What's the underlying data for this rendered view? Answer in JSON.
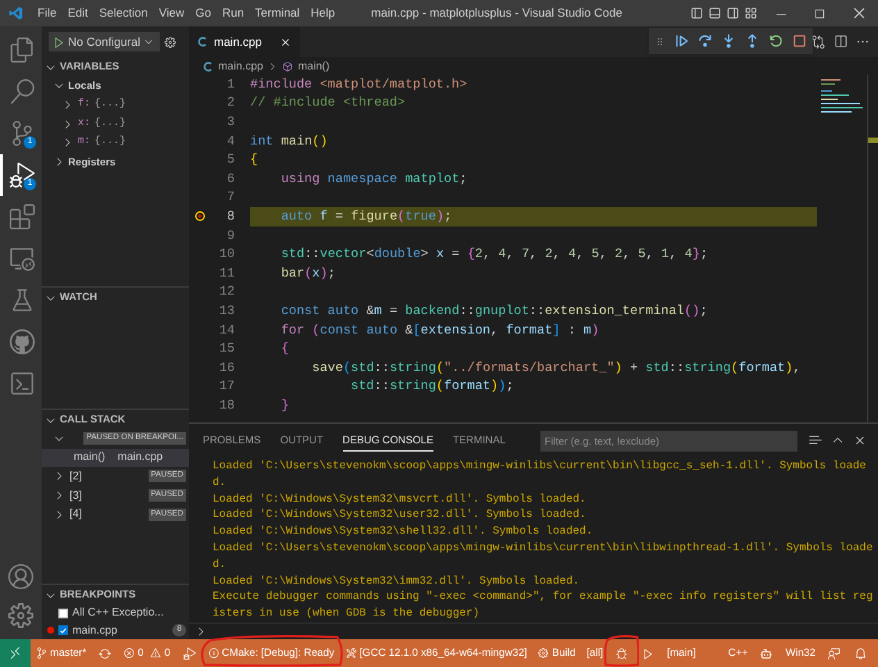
{
  "title_bar": {
    "menu": [
      "File",
      "Edit",
      "Selection",
      "View",
      "Go",
      "Run",
      "Terminal",
      "Help"
    ],
    "title": "main.cpp - matplotplusplus - Visual Studio Code"
  },
  "activity_bar": {
    "items": [
      {
        "kind": "explorer",
        "selected": false
      },
      {
        "kind": "search",
        "selected": false
      },
      {
        "kind": "scm",
        "selected": false,
        "badge": "1"
      },
      {
        "kind": "debug",
        "selected": true,
        "badge": "1"
      },
      {
        "kind": "extensions",
        "selected": false
      },
      {
        "kind": "remote",
        "selected": false
      },
      {
        "kind": "testing",
        "selected": false
      },
      {
        "kind": "github",
        "selected": false
      },
      {
        "kind": "terminal",
        "selected": false
      }
    ],
    "bottom": [
      {
        "kind": "account"
      },
      {
        "kind": "settings"
      }
    ]
  },
  "run_toolbar": {
    "configuration": "No Configural"
  },
  "variables": {
    "title": "VARIABLES",
    "scopes": [
      {
        "label": "Locals",
        "expanded": true,
        "children": [
          {
            "name": "f:",
            "value": "{...}"
          },
          {
            "name": "x:",
            "value": "{...}"
          },
          {
            "name": "m:",
            "value": "{...}"
          }
        ]
      },
      {
        "label": "Registers",
        "expanded": false
      }
    ]
  },
  "watch": {
    "title": "WATCH"
  },
  "call_stack": {
    "title": "CALL STACK",
    "threads": [
      {
        "state": "PAUSED ON BREAKPOI...",
        "expanded": true,
        "frames": [
          {
            "function": "main()",
            "file": "main.cpp",
            "selected": true
          }
        ]
      },
      {
        "label": "[2]",
        "state": "PAUSED",
        "expanded": false
      },
      {
        "label": "[3]",
        "state": "PAUSED",
        "expanded": false
      },
      {
        "label": "[4]",
        "state": "PAUSED",
        "expanded": false
      }
    ]
  },
  "breakpoints": {
    "title": "BREAKPOINTS",
    "items": [
      {
        "kind": "exception",
        "label": "All C++ Exceptio...",
        "checked": false
      },
      {
        "kind": "file",
        "label": "main.cpp",
        "checked": true,
        "line": "8"
      }
    ]
  },
  "editor": {
    "tabs": [
      {
        "label": "main.cpp",
        "selected": true
      }
    ],
    "breadcrumbs": [
      "main.cpp",
      "main()"
    ],
    "lines": [
      {
        "number": "1",
        "tokens": [
          {
            "kind": "ctrl",
            "text": "#include "
          },
          {
            "kind": "str",
            "text": "<matplot/matplot.h>"
          }
        ]
      },
      {
        "number": "2",
        "tokens": [
          {
            "kind": "cmt",
            "text": "// #include <thread>"
          }
        ]
      },
      {
        "number": "3"
      },
      {
        "number": "4",
        "tokens": [
          {
            "kind": "kw",
            "text": "int "
          },
          {
            "kind": "fn",
            "text": "main"
          },
          {
            "kind": "b1",
            "text": "()"
          }
        ]
      },
      {
        "number": "5",
        "tokens": [
          {
            "kind": "b1",
            "text": "{"
          }
        ]
      },
      {
        "number": "6",
        "tokens": [
          {
            "kind": "ctrl",
            "text": "    using "
          },
          {
            "kind": "kw",
            "text": "namespace "
          },
          {
            "kind": "type",
            "text": "matplot"
          },
          {
            "kind": "p",
            "text": ";"
          }
        ]
      },
      {
        "number": "7"
      },
      {
        "number": "8",
        "paused": true,
        "tokens": [
          {
            "kind": "kw",
            "text": "    auto "
          },
          {
            "kind": "var",
            "text": "f"
          },
          {
            "kind": "p",
            "text": " = "
          },
          {
            "kind": "fn",
            "text": "figure"
          },
          {
            "kind": "b2",
            "text": "("
          },
          {
            "kind": "kw",
            "text": "true"
          },
          {
            "kind": "b2",
            "text": ")"
          },
          {
            "kind": "p",
            "text": ";"
          }
        ]
      },
      {
        "number": "9"
      },
      {
        "number": "10",
        "tokens": [
          {
            "kind": "type",
            "text": "    std"
          },
          {
            "kind": "p",
            "text": "::"
          },
          {
            "kind": "type",
            "text": "vector"
          },
          {
            "kind": "p",
            "text": "<"
          },
          {
            "kind": "kw",
            "text": "double"
          },
          {
            "kind": "p",
            "text": "> "
          },
          {
            "kind": "var",
            "text": "x"
          },
          {
            "kind": "p",
            "text": " = "
          },
          {
            "kind": "b2",
            "text": "{"
          },
          {
            "kind": "num",
            "text": "2"
          },
          {
            "kind": "p",
            "text": ", "
          },
          {
            "kind": "num",
            "text": "4"
          },
          {
            "kind": "p",
            "text": ", "
          },
          {
            "kind": "num",
            "text": "7"
          },
          {
            "kind": "p",
            "text": ", "
          },
          {
            "kind": "num",
            "text": "2"
          },
          {
            "kind": "p",
            "text": ", "
          },
          {
            "kind": "num",
            "text": "4"
          },
          {
            "kind": "p",
            "text": ", "
          },
          {
            "kind": "num",
            "text": "5"
          },
          {
            "kind": "p",
            "text": ", "
          },
          {
            "kind": "num",
            "text": "2"
          },
          {
            "kind": "p",
            "text": ", "
          },
          {
            "kind": "num",
            "text": "5"
          },
          {
            "kind": "p",
            "text": ", "
          },
          {
            "kind": "num",
            "text": "1"
          },
          {
            "kind": "p",
            "text": ", "
          },
          {
            "kind": "num",
            "text": "4"
          },
          {
            "kind": "b2",
            "text": "}"
          },
          {
            "kind": "p",
            "text": ";"
          }
        ]
      },
      {
        "number": "11",
        "tokens": [
          {
            "kind": "fn",
            "text": "    bar"
          },
          {
            "kind": "b2",
            "text": "("
          },
          {
            "kind": "var",
            "text": "x"
          },
          {
            "kind": "b2",
            "text": ")"
          },
          {
            "kind": "p",
            "text": ";"
          }
        ]
      },
      {
        "number": "12"
      },
      {
        "number": "13",
        "tokens": [
          {
            "kind": "kw",
            "text": "    const auto "
          },
          {
            "kind": "p",
            "text": "&"
          },
          {
            "kind": "var",
            "text": "m"
          },
          {
            "kind": "p",
            "text": " = "
          },
          {
            "kind": "type",
            "text": "backend"
          },
          {
            "kind": "p",
            "text": "::"
          },
          {
            "kind": "type",
            "text": "gnuplot"
          },
          {
            "kind": "p",
            "text": "::"
          },
          {
            "kind": "fn",
            "text": "extension_terminal"
          },
          {
            "kind": "b2",
            "text": "()"
          },
          {
            "kind": "p",
            "text": ";"
          }
        ]
      },
      {
        "number": "14",
        "tokens": [
          {
            "kind": "ctrl",
            "text": "    for "
          },
          {
            "kind": "b2",
            "text": "("
          },
          {
            "kind": "kw",
            "text": "const auto "
          },
          {
            "kind": "p",
            "text": "&"
          },
          {
            "kind": "b3",
            "text": "["
          },
          {
            "kind": "var",
            "text": "extension"
          },
          {
            "kind": "p",
            "text": ", "
          },
          {
            "kind": "var",
            "text": "format"
          },
          {
            "kind": "b3",
            "text": "]"
          },
          {
            "kind": "p",
            "text": " : "
          },
          {
            "kind": "var",
            "text": "m"
          },
          {
            "kind": "b2",
            "text": ")"
          }
        ]
      },
      {
        "number": "15",
        "tokens": [
          {
            "kind": "b2",
            "text": "    {"
          }
        ]
      },
      {
        "number": "16",
        "tokens": [
          {
            "kind": "fn",
            "text": "        save"
          },
          {
            "kind": "b3",
            "text": "("
          },
          {
            "kind": "type",
            "text": "std"
          },
          {
            "kind": "p",
            "text": "::"
          },
          {
            "kind": "type",
            "text": "string"
          },
          {
            "kind": "b1",
            "text": "("
          },
          {
            "kind": "str",
            "text": "\"../formats/barchart_\""
          },
          {
            "kind": "b1",
            "text": ")"
          },
          {
            "kind": "p",
            "text": " + "
          },
          {
            "kind": "type",
            "text": "std"
          },
          {
            "kind": "p",
            "text": "::"
          },
          {
            "kind": "type",
            "text": "string"
          },
          {
            "kind": "b1",
            "text": "("
          },
          {
            "kind": "var",
            "text": "format"
          },
          {
            "kind": "b1",
            "text": ")"
          },
          {
            "kind": "p",
            "text": ","
          }
        ]
      },
      {
        "number": "17",
        "tokens": [
          {
            "kind": "type",
            "text": "             std"
          },
          {
            "kind": "p",
            "text": "::"
          },
          {
            "kind": "type",
            "text": "string"
          },
          {
            "kind": "b1",
            "text": "("
          },
          {
            "kind": "var",
            "text": "format"
          },
          {
            "kind": "b1",
            "text": ")"
          },
          {
            "kind": "b3",
            "text": ")"
          },
          {
            "kind": "p",
            "text": ";"
          }
        ]
      },
      {
        "number": "18",
        "tokens": [
          {
            "kind": "b2",
            "text": "    }"
          }
        ]
      }
    ]
  },
  "panel": {
    "tabs": [
      {
        "label": "PROBLEMS",
        "selected": false
      },
      {
        "label": "OUTPUT",
        "selected": false
      },
      {
        "label": "DEBUG CONSOLE",
        "selected": true
      },
      {
        "label": "TERMINAL",
        "selected": false
      }
    ],
    "filter": {
      "placeholder": "Filter (e.g. text, !exclude)"
    },
    "console": [
      "Loaded 'C:\\Users\\stevenokm\\scoop\\apps\\mingw-winlibs\\current\\bin\\libgcc_s_seh-1.dll'. Symbols loade",
      "d.",
      "Loaded 'C:\\Windows\\System32\\msvcrt.dll'. Symbols loaded.",
      "Loaded 'C:\\Windows\\System32\\user32.dll'. Symbols loaded.",
      "Loaded 'C:\\Windows\\System32\\shell32.dll'. Symbols loaded.",
      "Loaded 'C:\\Users\\stevenokm\\scoop\\apps\\mingw-winlibs\\current\\bin\\libwinpthread-1.dll'. Symbols loade",
      "d.",
      "Loaded 'C:\\Windows\\System32\\imm32.dll'. Symbols loaded.",
      "Execute debugger commands using \"-exec <command>\", for example \"-exec info registers\" will list reg",
      "isters in use (when GDB is the debugger)"
    ]
  },
  "status_bar": {
    "left": [
      {
        "kind": "remote"
      },
      {
        "kind": "branch",
        "text": "master*"
      },
      {
        "kind": "sync"
      },
      {
        "kind": "problems",
        "errors": "0",
        "warnings": "0"
      },
      {
        "kind": "launch"
      },
      {
        "kind": "cmake",
        "text": "CMake: [Debug]: Ready",
        "circled": true
      },
      {
        "kind": "kit",
        "text": "[GCC 12.1.0 x86_64-w64-mingw32]"
      },
      {
        "kind": "build",
        "text": "Build"
      },
      {
        "kind": "target",
        "text": "[all]"
      },
      {
        "kind": "debug",
        "circled": true
      },
      {
        "kind": "run"
      },
      {
        "kind": "plain",
        "text": "[main]"
      }
    ],
    "right": [
      {
        "kind": "plain",
        "text": "C++"
      },
      {
        "kind": "bot"
      },
      {
        "kind": "plain",
        "text": "Win32"
      },
      {
        "kind": "feedback"
      },
      {
        "kind": "bell"
      }
    ]
  }
}
